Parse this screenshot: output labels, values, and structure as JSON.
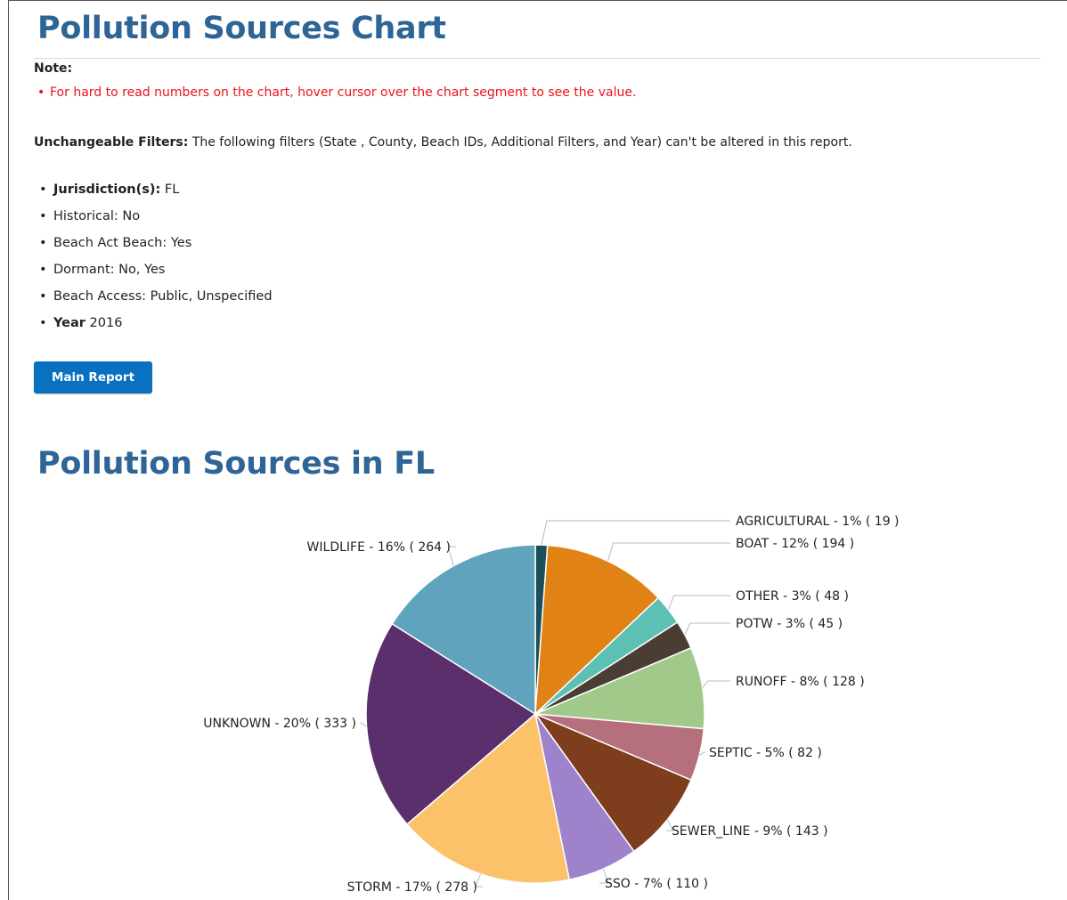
{
  "page": {
    "title": "Pollution Sources Chart",
    "note_label": "Note:",
    "notes": [
      "For hard to read numbers on the chart, hover cursor over the chart segment to see the value."
    ],
    "filters_label": "Unchangeable Filters:",
    "filters_text": " The following filters (State , County, Beach IDs, Additional Filters, and Year) can't be altered in this report.",
    "filters": [
      {
        "label": "Jurisdiction(s):",
        "value": " FL",
        "bold": true
      },
      {
        "label": "Historical: No",
        "value": "",
        "bold": false
      },
      {
        "label": "Beach Act Beach: Yes",
        "value": "",
        "bold": false
      },
      {
        "label": "Dormant: No, Yes",
        "value": "",
        "bold": false
      },
      {
        "label": "Beach Access: Public, Unspecified",
        "value": "",
        "bold": false
      },
      {
        "label": "Year",
        "value": " 2016",
        "bold": true
      }
    ],
    "main_report_label": "Main Report",
    "accent_color": "#2e6596",
    "button_color": "#0a71c0",
    "note_color": "#e8141b"
  },
  "chart_data": {
    "type": "pie",
    "title": "Pollution Sources in FL",
    "slices": [
      {
        "name": "AGRICULTURAL",
        "value": 19,
        "percent": 1,
        "color": "#1b4f5a",
        "label": "AGRICULTURAL - 1% ( 19 )"
      },
      {
        "name": "BOAT",
        "value": 194,
        "percent": 12,
        "color": "#e08314",
        "label": "BOAT - 12% ( 194 )"
      },
      {
        "name": "OTHER",
        "value": 48,
        "percent": 3,
        "color": "#5cc0b5",
        "label": "OTHER - 3% ( 48 )"
      },
      {
        "name": "POTW",
        "value": 45,
        "percent": 3,
        "color": "#4a3d33",
        "label": "POTW - 3% ( 45 )"
      },
      {
        "name": "RUNOFF",
        "value": 128,
        "percent": 8,
        "color": "#a1c98a",
        "label": "RUNOFF - 8% ( 128 )"
      },
      {
        "name": "SEPTIC",
        "value": 82,
        "percent": 5,
        "color": "#b56f7d",
        "label": "SEPTIC - 5% ( 82 )"
      },
      {
        "name": "SEWER_LINE",
        "value": 143,
        "percent": 9,
        "color": "#7e3d1c",
        "label": "SEWER_LINE - 9% ( 143 )"
      },
      {
        "name": "SSO",
        "value": 110,
        "percent": 7,
        "color": "#9e82cc",
        "label": "SSO - 7% ( 110 )"
      },
      {
        "name": "STORM",
        "value": 278,
        "percent": 17,
        "color": "#fbc269",
        "label": "STORM - 17% ( 278 )"
      },
      {
        "name": "UNKNOWN",
        "value": 333,
        "percent": 20,
        "color": "#5a2f6b",
        "label": "UNKNOWN - 20% ( 333 )"
      },
      {
        "name": "WILDLIFE",
        "value": 264,
        "percent": 16,
        "color": "#5fa3bd",
        "label": "WILDLIFE - 16% ( 264 )"
      }
    ]
  }
}
